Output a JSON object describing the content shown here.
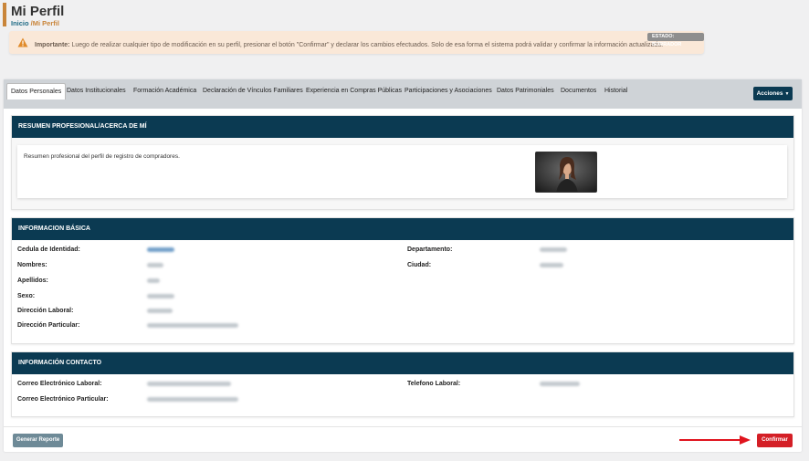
{
  "header": {
    "title": "Mi Perfil",
    "breadcrumb_home": "Inicio",
    "breadcrumb_sep": " /",
    "breadcrumb_current": "Mi Perfil"
  },
  "alert": {
    "icon": "warning-icon",
    "bold": "Importante:",
    "text": " Luego de realizar cualquier tipo de modificación en su perfil, presionar el botón \"Confirmar\" y declarar los cambios efectuados. Solo de esa forma el sistema podrá validar y confirmar la información actualizada.",
    "badge": "ESTADO: BORRADOR",
    "color": "#fae8d8"
  },
  "tabs": [
    {
      "label": "Datos Personales",
      "active": true
    },
    {
      "label": "Datos Institucionales"
    },
    {
      "label": "Formación Académica"
    },
    {
      "label": "Declaración de Vínculos Familiares"
    },
    {
      "label": "Experiencia en Compras Públicas"
    },
    {
      "label": "Participaciones y Asociaciones"
    },
    {
      "label": "Datos Patrimoniales"
    },
    {
      "label": "Documentos"
    },
    {
      "label": "Historial"
    }
  ],
  "actions_button": {
    "label": "Acciones",
    "caret": "▼"
  },
  "resumen": {
    "title": "RESUMEN PROFESIONAL/ACERCA DE MÍ",
    "text": "Resumen profesional del perfil de registro de compradores.",
    "photo": "profile-photo"
  },
  "basica": {
    "title": "INFORMACION BÁSICA",
    "left_labels": [
      "Cedula de Identidad:",
      "Nombres:",
      "Apellidos:",
      "Sexo:",
      "Dirección Laboral:",
      "Dirección Particular:"
    ],
    "right_labels": [
      "Departamento:",
      "Ciudad:"
    ]
  },
  "contacto": {
    "title": "INFORMACIÓN CONTACTO",
    "left_labels": [
      "Correo Electrónico Laboral:",
      "Correo Electrónico Particular:"
    ],
    "right_labels": [
      "Telefono Laboral:"
    ]
  },
  "footer": {
    "report_button": "Generar Reporte",
    "confirm_button": "Confirmar"
  },
  "colors": {
    "primary": "#0b3a52",
    "accent": "#c9853a",
    "danger": "#d41f26"
  }
}
